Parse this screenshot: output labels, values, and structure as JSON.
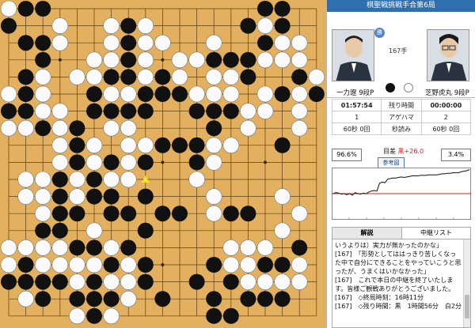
{
  "header": {
    "title": "棋聖戦挑戦手合第6局"
  },
  "move_number": "167手",
  "badge": "勝",
  "players": {
    "black": {
      "name": "一力遼 9段P"
    },
    "white": {
      "name": "芝野虎丸 9段P"
    }
  },
  "info": {
    "black_time": "01:57:54",
    "time_label": "残り時間",
    "white_time": "00:00:00",
    "black_captures": "1",
    "captures_label": "アゲハマ",
    "white_captures": "2",
    "black_byoyomi": "60秒 0回",
    "byoyomi_label": "秒読み",
    "white_byoyomi": "60秒 0回"
  },
  "win_rate": {
    "black": "96.6%",
    "white": "3.4%"
  },
  "score_diff": {
    "label": "目差 ",
    "value": "黒+26.0"
  },
  "reference_button": "参考図",
  "win_rate_series": [
    50,
    52,
    51,
    49,
    50,
    48,
    50,
    47,
    52,
    50,
    49,
    51,
    50,
    53,
    55,
    56,
    55,
    70,
    72,
    71,
    78,
    79,
    80,
    80,
    81,
    82,
    81,
    82,
    83,
    84,
    84,
    84,
    85,
    85,
    85,
    86,
    86,
    86,
    86,
    87,
    88,
    88,
    89,
    89,
    90,
    90,
    90,
    92,
    93,
    94,
    96
  ],
  "tabs": [
    "解説",
    "中継リスト"
  ],
  "commentary": [
    "いうよりは）実力が無かったのかな」",
    "[167]　「形勢としてははっきり苦しくなった中で自分にできることをやっていこうと思ったが、うまくはいかなかった」",
    "[167]　これで本日の中継を終了いたします。皆様ご観戦ありがとうございました。",
    "[167]　◇終局時刻：16時11分",
    "[167]　◇残り時間：黒　1時間56分　白2分"
  ],
  "board": {
    "last_move": [
      8,
      10
    ],
    "black": [
      [
        1,
        0
      ],
      [
        2,
        0
      ],
      [
        0,
        1
      ],
      [
        1,
        2
      ],
      [
        2,
        2
      ],
      [
        2,
        3
      ],
      [
        1,
        4
      ],
      [
        1,
        5
      ],
      [
        1,
        6
      ],
      [
        0,
        6
      ],
      [
        2,
        7
      ],
      [
        4,
        7
      ],
      [
        4,
        8
      ],
      [
        4,
        9
      ],
      [
        3,
        10
      ],
      [
        3,
        11
      ],
      [
        3,
        12
      ],
      [
        4,
        12
      ],
      [
        2,
        13
      ],
      [
        3,
        13
      ],
      [
        4,
        14
      ],
      [
        5,
        14
      ],
      [
        1,
        15
      ],
      [
        0,
        16
      ],
      [
        1,
        16
      ],
      [
        2,
        16
      ],
      [
        3,
        16
      ],
      [
        4,
        17
      ],
      [
        5,
        17
      ],
      [
        2,
        17
      ],
      [
        6,
        15
      ],
      [
        5,
        16
      ],
      [
        6,
        17
      ],
      [
        7,
        1
      ],
      [
        7,
        2
      ],
      [
        7,
        3
      ],
      [
        7,
        4
      ],
      [
        6,
        4
      ],
      [
        5,
        5
      ],
      [
        5,
        6
      ],
      [
        6,
        6
      ],
      [
        7,
        6
      ],
      [
        8,
        5
      ],
      [
        9,
        5
      ],
      [
        9,
        4
      ],
      [
        6,
        9
      ],
      [
        5,
        10
      ],
      [
        6,
        11
      ],
      [
        6,
        12
      ],
      [
        7,
        12
      ],
      [
        5,
        11
      ],
      [
        8,
        6
      ],
      [
        8,
        9
      ],
      [
        8,
        11
      ],
      [
        9,
        8
      ],
      [
        9,
        12
      ],
      [
        10,
        12
      ],
      [
        10,
        8
      ],
      [
        11,
        8
      ],
      [
        10,
        5
      ],
      [
        8,
        16
      ],
      [
        8,
        15
      ],
      [
        11,
        9
      ],
      [
        8,
        13
      ],
      [
        7,
        14
      ],
      [
        9,
        17
      ],
      [
        5,
        18
      ],
      [
        11,
        6
      ],
      [
        12,
        3
      ],
      [
        12,
        6
      ],
      [
        12,
        7
      ],
      [
        13,
        6
      ],
      [
        13,
        3
      ],
      [
        14,
        3
      ],
      [
        14,
        4
      ],
      [
        15,
        0
      ],
      [
        16,
        0
      ],
      [
        14,
        1
      ],
      [
        15,
        2
      ],
      [
        16,
        1
      ],
      [
        16,
        5
      ],
      [
        17,
        4
      ],
      [
        16,
        8
      ],
      [
        14,
        12
      ],
      [
        13,
        12
      ],
      [
        12,
        15
      ],
      [
        11,
        16
      ],
      [
        12,
        18
      ],
      [
        13,
        18
      ],
      [
        14,
        17
      ],
      [
        15,
        17
      ],
      [
        16,
        17
      ],
      [
        16,
        15
      ],
      [
        17,
        14
      ],
      [
        18,
        5
      ],
      [
        15,
        15
      ],
      [
        12,
        17
      ],
      [
        13,
        16
      ]
    ],
    "white": [
      [
        0,
        0
      ],
      [
        3,
        1
      ],
      [
        3,
        2
      ],
      [
        2,
        4
      ],
      [
        2,
        5
      ],
      [
        2,
        6
      ],
      [
        0,
        5
      ],
      [
        3,
        6
      ],
      [
        0,
        7
      ],
      [
        1,
        7
      ],
      [
        3,
        7
      ],
      [
        3,
        8
      ],
      [
        3,
        9
      ],
      [
        1,
        10
      ],
      [
        2,
        10
      ],
      [
        1,
        11
      ],
      [
        2,
        11
      ],
      [
        4,
        11
      ],
      [
        2,
        12
      ],
      [
        0,
        14
      ],
      [
        1,
        14
      ],
      [
        2,
        14
      ],
      [
        3,
        14
      ],
      [
        3,
        15
      ],
      [
        4,
        15
      ],
      [
        4,
        16
      ],
      [
        5,
        15
      ],
      [
        2,
        15
      ],
      [
        1,
        17
      ],
      [
        5,
        13
      ],
      [
        6,
        14
      ],
      [
        7,
        15
      ],
      [
        7,
        16
      ],
      [
        6,
        16
      ],
      [
        4,
        18
      ],
      [
        6,
        18
      ],
      [
        7,
        17
      ],
      [
        6,
        1
      ],
      [
        6,
        2
      ],
      [
        5,
        3
      ],
      [
        4,
        4
      ],
      [
        6,
        3
      ],
      [
        5,
        4
      ],
      [
        7,
        5
      ],
      [
        6,
        5
      ],
      [
        8,
        4
      ],
      [
        8,
        1
      ],
      [
        8,
        2
      ],
      [
        8,
        3
      ],
      [
        6,
        7
      ],
      [
        7,
        7
      ],
      [
        7,
        8
      ],
      [
        5,
        8
      ],
      [
        5,
        9
      ],
      [
        6,
        10
      ],
      [
        4,
        10
      ],
      [
        7,
        10
      ],
      [
        7,
        9
      ],
      [
        8,
        8
      ],
      [
        10,
        3
      ],
      [
        10,
        4
      ],
      [
        9,
        2
      ],
      [
        12,
        2
      ],
      [
        11,
        3
      ],
      [
        12,
        5
      ],
      [
        11,
        5
      ],
      [
        13,
        4
      ],
      [
        12,
        4
      ],
      [
        13,
        5
      ],
      [
        12,
        8
      ],
      [
        12,
        9
      ],
      [
        11,
        10
      ],
      [
        12,
        11
      ],
      [
        12,
        12
      ],
      [
        13,
        8
      ],
      [
        14,
        7
      ],
      [
        15,
        6
      ],
      [
        14,
        6
      ],
      [
        15,
        5
      ],
      [
        15,
        1
      ],
      [
        15,
        3
      ],
      [
        16,
        2
      ],
      [
        17,
        2
      ],
      [
        16,
        3
      ],
      [
        17,
        3
      ],
      [
        17,
        5
      ],
      [
        17,
        6
      ],
      [
        18,
        4
      ],
      [
        17,
        7
      ],
      [
        16,
        11
      ],
      [
        17,
        12
      ],
      [
        16,
        13
      ],
      [
        17,
        15
      ],
      [
        16,
        16
      ],
      [
        17,
        16
      ],
      [
        15,
        16
      ],
      [
        14,
        15
      ],
      [
        14,
        16
      ],
      [
        13,
        15
      ],
      [
        13,
        14
      ],
      [
        14,
        14
      ],
      [
        15,
        14
      ],
      [
        0,
        15
      ]
    ]
  }
}
